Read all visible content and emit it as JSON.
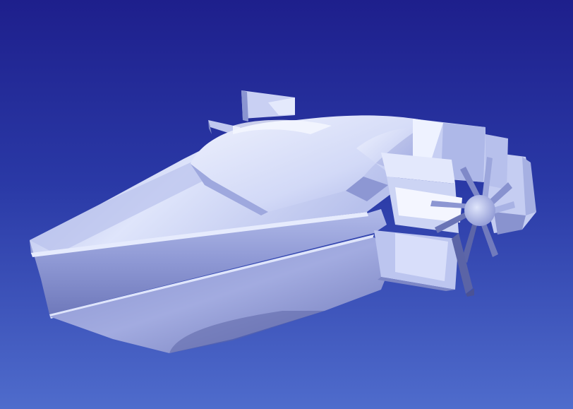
{
  "scene": {
    "kind": "3d-render",
    "subject": "paddle-wheel-boat-hull",
    "colors": {
      "background_top": "#1e1f8c",
      "background_bottom": "#4f6ccc",
      "hull_light": "#e2e8fb",
      "hull_mid": "#b4bde9",
      "hull_dark": "#7d87c6",
      "hull_shadow": "#5d66a8",
      "glass": "#d4dcf8"
    }
  }
}
